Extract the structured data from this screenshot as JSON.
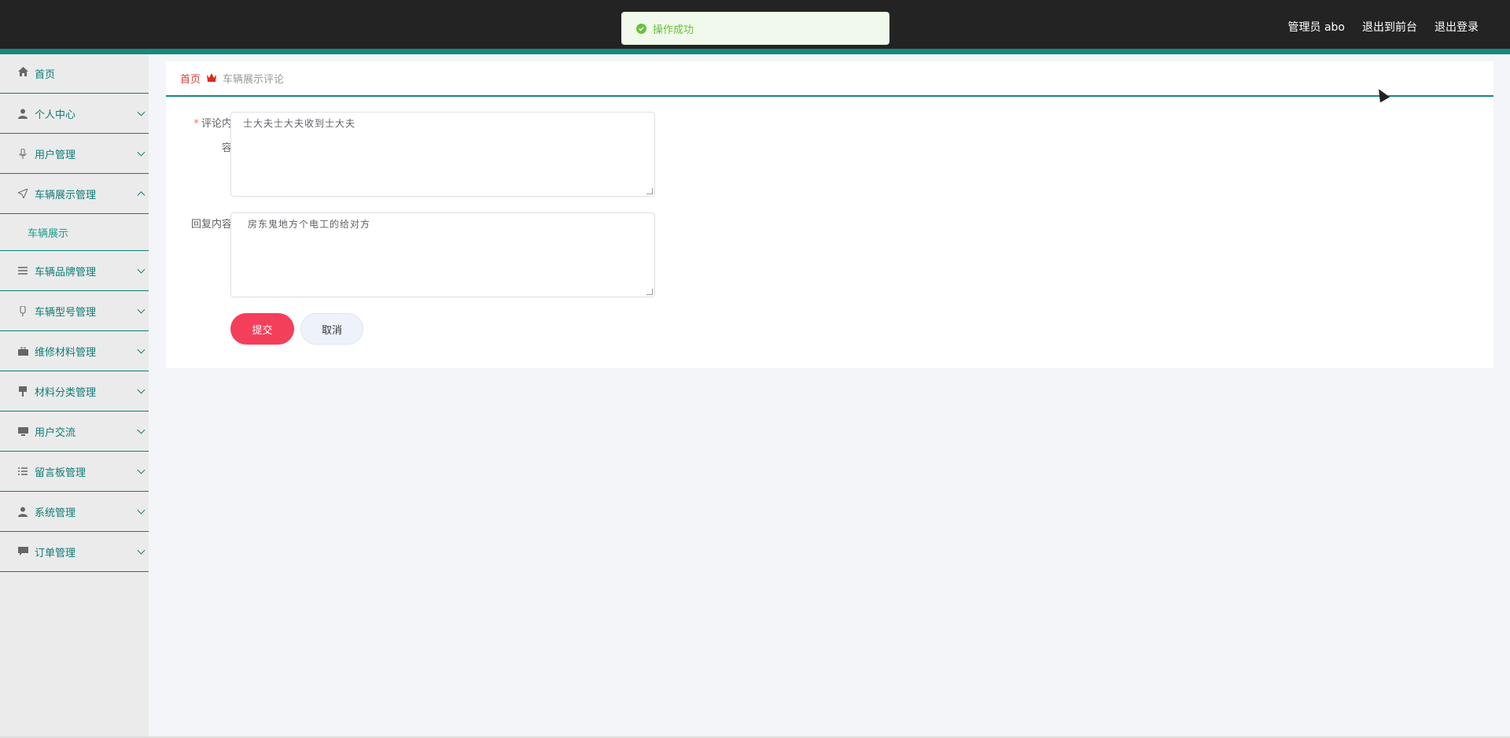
{
  "toast": {
    "message": "操作成功",
    "icon": "check-circle-icon"
  },
  "header": {
    "user": "管理员 abo",
    "front_link": "退出到前台",
    "logout_link": "退出登录"
  },
  "sidebar": {
    "items": [
      {
        "label": "首页",
        "icon": "home-icon"
      },
      {
        "label": "个人中心",
        "icon": "user-icon"
      },
      {
        "label": "用户管理",
        "icon": "microphone-icon"
      },
      {
        "label": "车辆展示管理",
        "icon": "send-icon"
      },
      {
        "label": "车辆品牌管理",
        "icon": "list-icon"
      },
      {
        "label": "车辆型号管理",
        "icon": "bottle-icon"
      },
      {
        "label": "维修材料管理",
        "icon": "briefcase-icon"
      },
      {
        "label": "材料分类管理",
        "icon": "pin-icon"
      },
      {
        "label": "用户交流",
        "icon": "monitor-icon"
      },
      {
        "label": "留言板管理",
        "icon": "list-icon"
      },
      {
        "label": "系统管理",
        "icon": "user-icon"
      },
      {
        "label": "订单管理",
        "icon": "chat-icon"
      }
    ],
    "submenu": {
      "label": "车辆展示"
    }
  },
  "breadcrumb": {
    "home": "首页",
    "current": "车辆展示评论"
  },
  "form": {
    "comment_label_line1": "评论内",
    "comment_label_line2": "容",
    "comment_required": "*",
    "comment_value": "士大夫士大夫收到士大夫",
    "reply_label": "回复内容",
    "reply_value": "房东鬼地方个电工的给对方",
    "submit": "提交",
    "cancel": "取消"
  },
  "colors": {
    "accent": "#17887f",
    "topbar": "#232323",
    "submit": "#f43f5b",
    "toast_text": "#67c23a"
  }
}
